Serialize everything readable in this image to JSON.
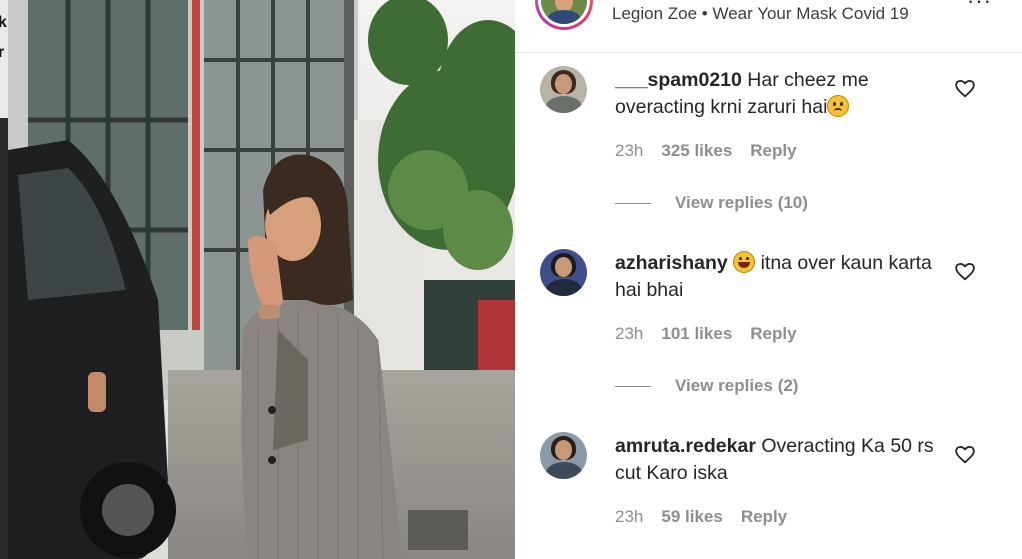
{
  "left_edge_text": [
    "k",
    "r"
  ],
  "post_header": {
    "location_text": "Legion Zoe • Wear Your Mask Covid 19",
    "more_options_label": "···"
  },
  "comments": [
    {
      "username": "___spam0210",
      "text": "Har cheez me overacting krni zaruri hai",
      "emoji": "frowning-face",
      "time": "23h",
      "likes": "325 likes",
      "reply_label": "Reply",
      "view_replies": "View replies (10)"
    },
    {
      "username": "azharishany",
      "emoji": "grinning-squinting-face",
      "text": "itna over kaun karta hai bhai",
      "time": "23h",
      "likes": "101 likes",
      "reply_label": "Reply",
      "view_replies": "View replies (2)"
    },
    {
      "username": "amruta.redekar",
      "text": "Overacting Ka 50 rs cut Karo iska",
      "time": "23h",
      "likes": "59 likes",
      "reply_label": "Reply"
    }
  ],
  "colors": {
    "text_primary": "#262626",
    "text_secondary": "#8e8e8e",
    "divider": "#e6e6e6",
    "story_ring": "#e43a6b"
  }
}
